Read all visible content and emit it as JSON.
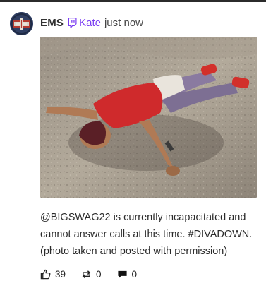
{
  "post": {
    "author_handle": "EMS",
    "streamer_name": "Kate",
    "timestamp": "just now",
    "caption": "@BIGSWAG22 is currently incapacitated and cannot answer calls at this time. #DIVADOWN. (photo taken and posted with permission)",
    "image_description_icon": "photo"
  },
  "actions": {
    "likes": "39",
    "reposts": "0",
    "comments": "0"
  },
  "colors": {
    "streamer_accent": "#7a3df2",
    "top_bar": "#2b2b2b"
  },
  "icons": {
    "platform": "twitch-icon",
    "like": "thumbs-up-icon",
    "repost": "repost-arrows-icon",
    "comment": "speech-bubble-icon"
  }
}
